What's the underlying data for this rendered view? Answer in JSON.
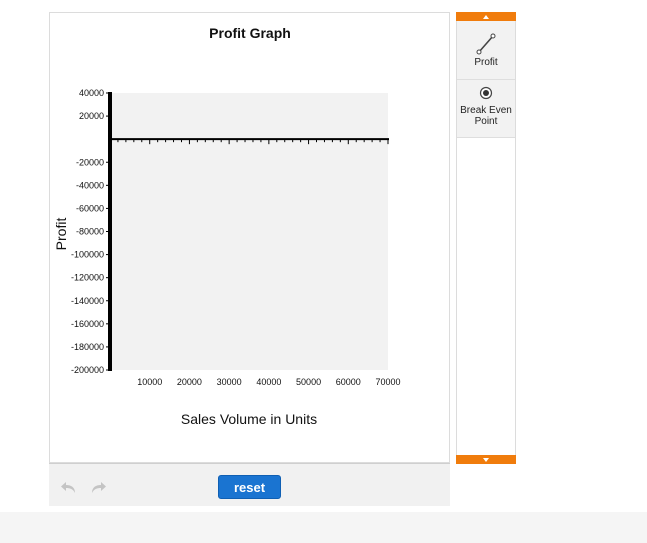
{
  "graph": {
    "title": "Profit Graph",
    "xlabel": "Sales Volume in Units",
    "ylabel": "Profit"
  },
  "chart_data": {
    "type": "line",
    "title": "Profit Graph",
    "xlabel": "Sales Volume in Units",
    "ylabel": "Profit",
    "xlim": [
      0,
      70000
    ],
    "ylim": [
      -200000,
      40000
    ],
    "x_ticks": [
      10000,
      20000,
      30000,
      40000,
      50000,
      60000,
      70000
    ],
    "y_ticks": [
      40000,
      20000,
      -20000,
      -40000,
      -60000,
      -80000,
      -100000,
      -120000,
      -140000,
      -160000,
      -180000,
      -200000
    ],
    "x_minor_step": 2000,
    "grid": false,
    "series": []
  },
  "tools": {
    "items": [
      {
        "label": "Profit",
        "icon": "line-segment-icon"
      },
      {
        "label_line1": "Break Even",
        "label_line2": "Point",
        "icon": "point-icon"
      }
    ]
  },
  "toolbar": {
    "reset_label": "reset",
    "undo_icon": "undo-icon",
    "redo_icon": "redo-icon"
  },
  "colors": {
    "accent": "#f07c0c",
    "button": "#1a74d1",
    "plot_bg": "#f2f2f2"
  }
}
